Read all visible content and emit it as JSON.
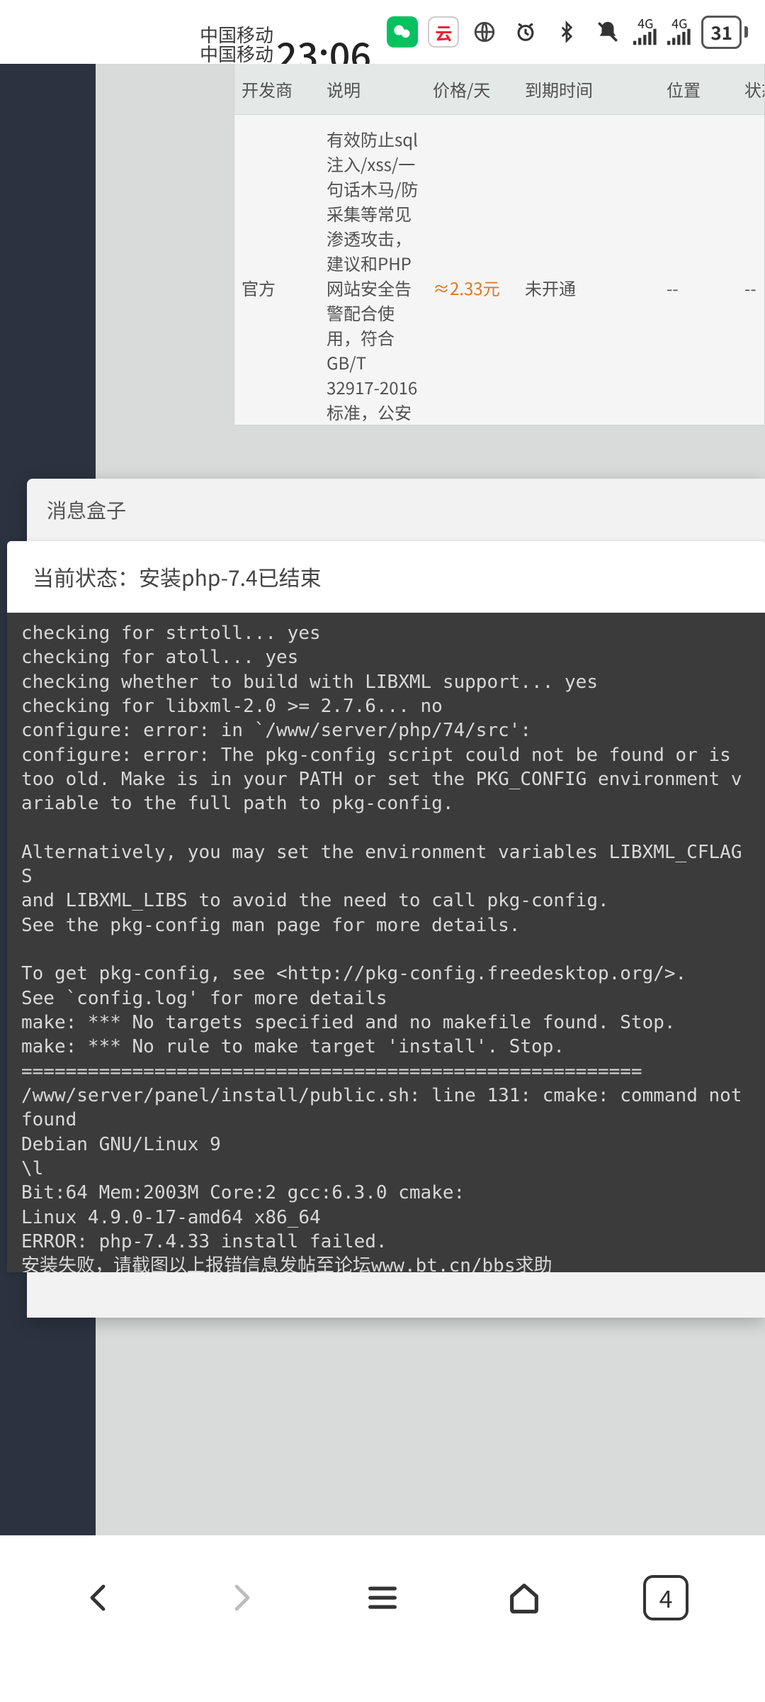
{
  "status_bar": {
    "carrier1": "中国移动",
    "carrier2": "中国移动",
    "time": "23:06",
    "net_label": "4G",
    "battery_pct": "31"
  },
  "table": {
    "headers": {
      "developer": "开发商",
      "description": "说明",
      "price": "价格/天",
      "expiry": "到期时间",
      "position": "位置",
      "status": "状态"
    },
    "row": {
      "developer": "官方",
      "description": "有效防止sql注入/xss/一句话木马/防采集等常见渗透攻击，建议和PHP网站安全告警配合使用，符合GB/T 32917-2016标准，公安三所安全认",
      "price": "≈2.33元",
      "expiry": "未开通",
      "position": "--",
      "status": "--"
    }
  },
  "modal": {
    "title": "消息盒子",
    "inner_status_prefix": "当前状态：",
    "inner_status": "安装php-7.4已结束"
  },
  "terminal_lines": "checking for strtoll... yes\nchecking for atoll... yes\nchecking whether to build with LIBXML support... yes\nchecking for libxml-2.0 >= 2.7.6... no\nconfigure: error: in `/www/server/php/74/src':\nconfigure: error: The pkg-config script could not be found or is too old. Make is in your PATH or set the PKG_CONFIG environment variable to the full path to pkg-config.\n\nAlternatively, you may set the environment variables LIBXML_CFLAGS\nand LIBXML_LIBS to avoid the need to call pkg-config.\nSee the pkg-config man page for more details.\n\nTo get pkg-config, see <http://pkg-config.freedesktop.org/>.\nSee `config.log' for more details\nmake: *** No targets specified and no makefile found. Stop.\nmake: *** No rule to make target 'install'. Stop.\n========================================================\n/www/server/panel/install/public.sh: line 131: cmake: command not found\nDebian GNU/Linux 9\n\\l\nBit:64 Mem:2003M Core:2 gcc:6.3.0 cmake:\nLinux 4.9.0-17-amd64 x86_64\nERROR: php-7.4.33 install failed.\n安装失败，请截图以上报错信息发帖至论坛www.bt.cn/bbs求助\ncat: /etc/redhat-release: No such file or directory\n|-Successify --- 命令已执行! ---",
  "bottom_nav": {
    "tab_count": "4"
  }
}
